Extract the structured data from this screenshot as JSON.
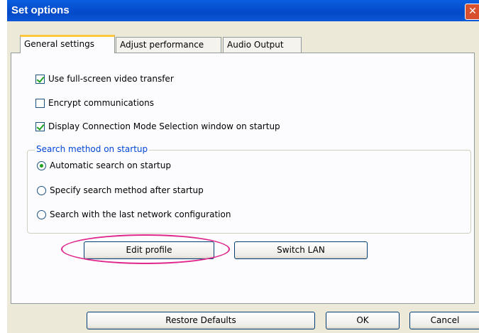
{
  "window": {
    "title": "Set options",
    "close_glyph": "✕"
  },
  "tabs": [
    {
      "label": "General settings",
      "active": true
    },
    {
      "label": "Adjust performance",
      "active": false
    },
    {
      "label": "Audio Output",
      "active": false
    }
  ],
  "checkboxes": [
    {
      "label": "Use full-screen video transfer",
      "checked": true
    },
    {
      "label": "Encrypt communications",
      "checked": false
    },
    {
      "label": "Display Connection Mode Selection window on startup",
      "checked": true
    }
  ],
  "search_group": {
    "label": "Search method on startup",
    "options": [
      {
        "label": "Automatic search on startup",
        "selected": true
      },
      {
        "label": "Specify search method after startup",
        "selected": false
      },
      {
        "label": "Search with the last network configuration",
        "selected": false
      }
    ]
  },
  "buttons": {
    "edit_profile": "Edit profile",
    "switch_lan": "Switch LAN",
    "restore_defaults": "Restore Defaults",
    "ok": "OK",
    "cancel": "Cancel"
  },
  "annotation": {
    "highlight_color": "#e0288c",
    "highlights": "edit_profile"
  },
  "colors": {
    "title_bar": "#0349c8",
    "group_label": "#0046d5",
    "check_mark": "#21a121"
  },
  "icons": {
    "close": "close-icon",
    "check": "checkmark-icon",
    "radio_dot": "radio-dot-icon"
  }
}
